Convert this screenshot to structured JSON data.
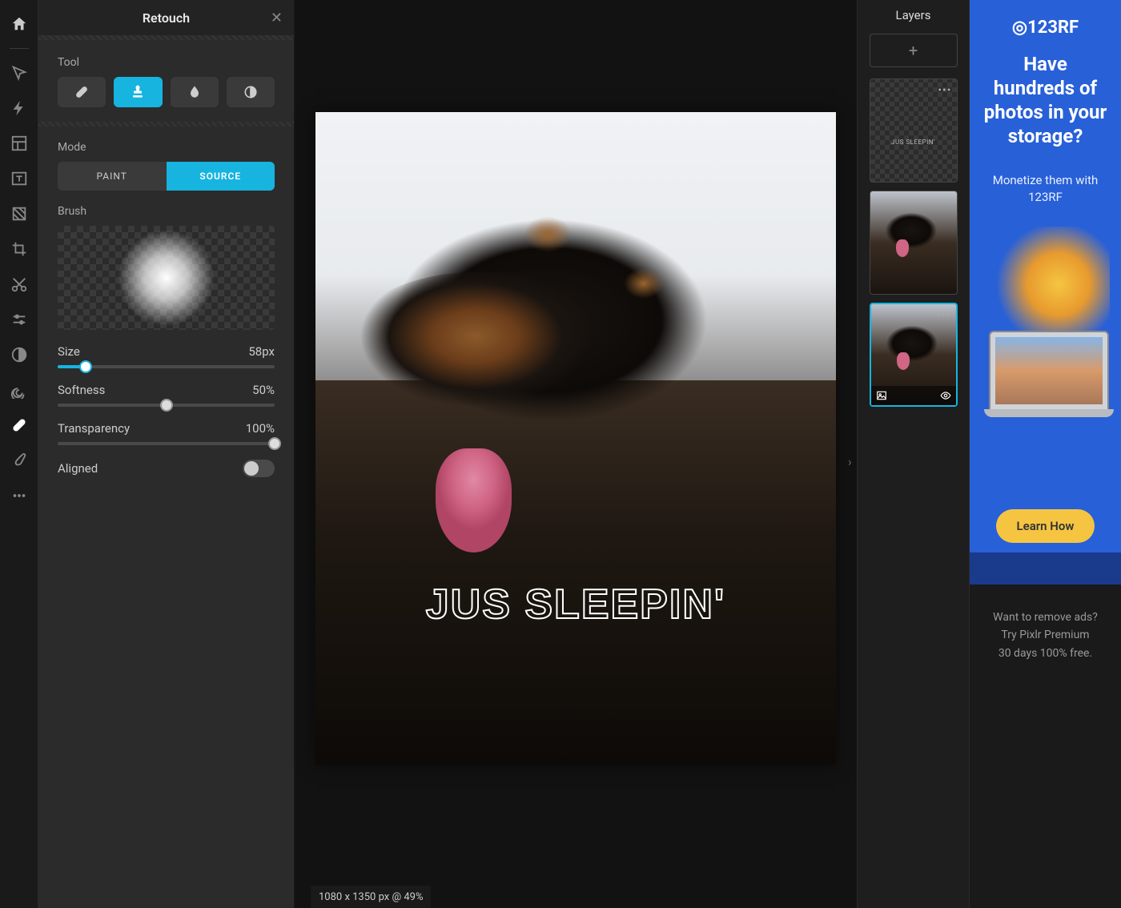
{
  "panel": {
    "title": "Retouch",
    "tool_section": "Tool",
    "tools": [
      "bandage",
      "stamp",
      "blur",
      "dodge"
    ],
    "active_tool": "stamp",
    "mode_section": "Mode",
    "modes": {
      "paint": "PAINT",
      "source": "SOURCE"
    },
    "active_mode": "source",
    "brush_section": "Brush",
    "size_label": "Size",
    "size_value": "58px",
    "size_pct": 13,
    "softness_label": "Softness",
    "softness_value": "50%",
    "softness_pct": 50,
    "transparency_label": "Transparency",
    "transparency_value": "100%",
    "transparency_pct": 100,
    "aligned_label": "Aligned",
    "aligned_on": false
  },
  "canvas": {
    "meme_text": "JUS SLEEPIN'",
    "status": "1080 x 1350 px @ 49%"
  },
  "layers": {
    "title": "Layers",
    "text_layer_label": "JUS SLEEPIN'"
  },
  "left_tools": [
    "home",
    "arrow",
    "bolt",
    "layout",
    "text",
    "fill",
    "crop",
    "cut",
    "adjust",
    "contrast",
    "spiral",
    "heal",
    "brush",
    "more"
  ],
  "ad": {
    "logo": "◎123RF",
    "headline": "Have hundreds of photos in your storage?",
    "sub": "Monetize them with 123RF",
    "button": "Learn How",
    "caption_l1": "Want to remove ads?",
    "caption_l2": "Try Pixlr Premium",
    "caption_l3": "30 days 100% free."
  }
}
